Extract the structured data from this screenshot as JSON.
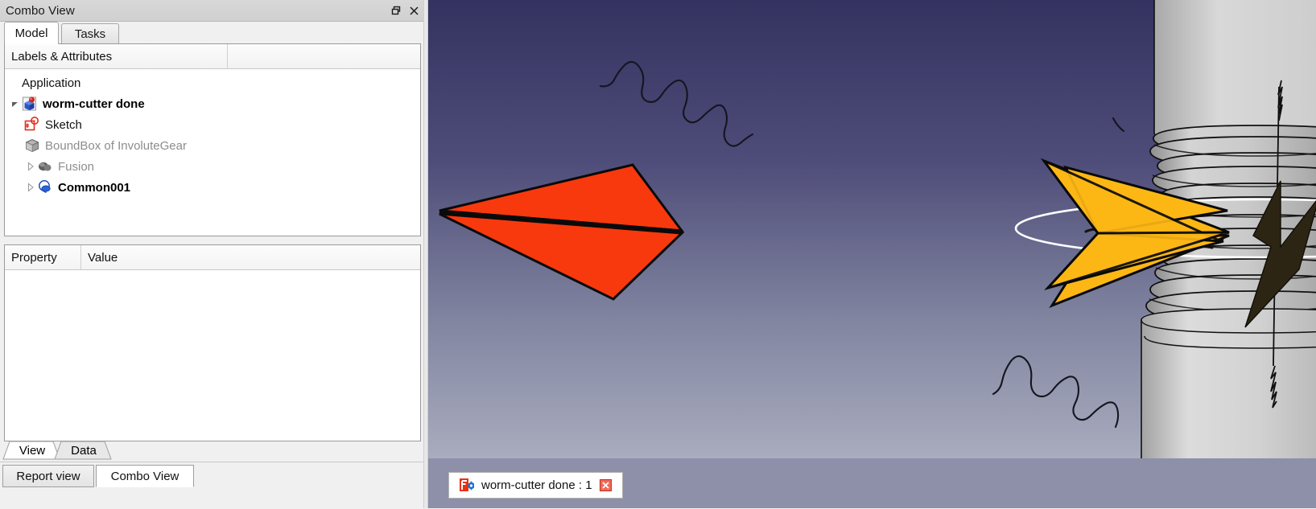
{
  "dock": {
    "title": "Combo View",
    "float_icon": "restore-icon",
    "close_icon": "close-icon"
  },
  "tabs": [
    {
      "label": "Model",
      "active": true
    },
    {
      "label": "Tasks",
      "active": false
    }
  ],
  "tree": {
    "columns": [
      "Labels & Attributes",
      ""
    ],
    "root_label": "Application",
    "items": [
      {
        "label": "worm-cutter done",
        "icon": "freecad-document-icon",
        "style": "bold",
        "expander": "expanded",
        "depth": 1
      },
      {
        "label": "Sketch",
        "icon": "sketch-icon",
        "style": "plain",
        "expander": "none",
        "depth": 2
      },
      {
        "label": "BoundBox of InvoluteGear",
        "icon": "boundbox-icon",
        "style": "gray",
        "expander": "none",
        "depth": 2
      },
      {
        "label": "Fusion",
        "icon": "fusion-icon",
        "style": "gray",
        "expander": "collapsed",
        "depth": 2
      },
      {
        "label": "Common001",
        "icon": "common-icon",
        "style": "bold",
        "expander": "collapsed",
        "depth": 2
      }
    ]
  },
  "properties": {
    "columns": [
      "Property",
      "Value"
    ],
    "rows": []
  },
  "view_data_tabs": [
    {
      "label": "View",
      "active": true
    },
    {
      "label": "Data",
      "active": false
    }
  ],
  "bottom_tabs": [
    {
      "label": "Report view",
      "active": false
    },
    {
      "label": "Combo View",
      "active": true
    }
  ],
  "view3d": {
    "document_tab": {
      "label": "worm-cutter done : 1",
      "icon": "freecad-logo-icon",
      "close_icon": "tab-close-icon"
    },
    "background_top": "#3b3a66",
    "background_bottom": "#a7aabd",
    "arrow_left_color": "#f93a0e",
    "arrow_right_color": "#fcb715",
    "pitch_circle_color": "#ffffff",
    "solid_color": "#c8c8c8",
    "edge_color": "#000000",
    "mdi_bar_color": "#8d90a8"
  },
  "colors": {
    "panel_bg": "#f0f0f0",
    "panel_white": "#ffffff",
    "border": "#9a9a9a",
    "title_bar": "#d4d4d4",
    "gray_text": "#8d8d8d"
  }
}
